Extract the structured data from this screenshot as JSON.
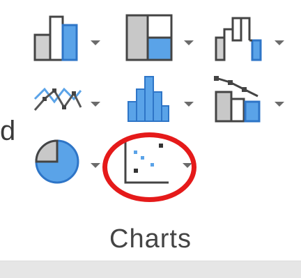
{
  "ribbon": {
    "group_label": "Charts",
    "left_edge_char": "d",
    "buttons": [
      {
        "name": "column-chart-icon"
      },
      {
        "name": "hierarchy-chart-icon"
      },
      {
        "name": "waterfall-chart-icon"
      },
      {
        "name": "line-chart-icon"
      },
      {
        "name": "statistic-chart-icon"
      },
      {
        "name": "combo-chart-icon"
      },
      {
        "name": "pie-chart-icon"
      },
      {
        "name": "scatter-chart-icon"
      }
    ],
    "highlight_color": "#e51a1a",
    "accent_blue": "#5aa3e8",
    "accent_gray": "#bfbfbf"
  }
}
